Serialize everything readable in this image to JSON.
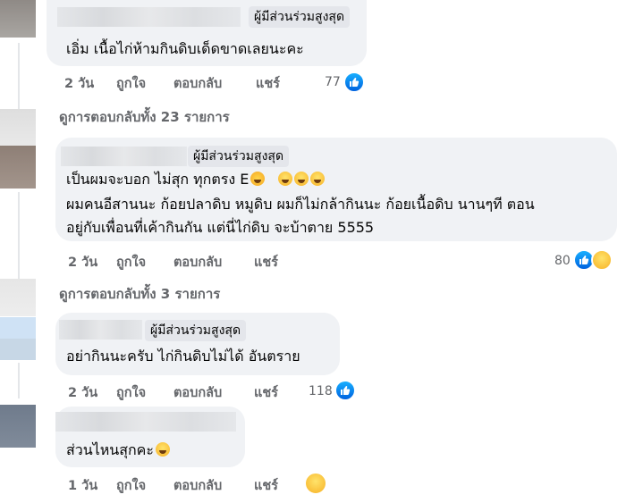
{
  "comments": [
    {
      "badge": "ผู้มีส่วนร่วมสูงสุด",
      "lines": [
        "เอิ่ม เนื้อไก่ห้ามกินดิบเด็ดขาดเลยนะคะ"
      ],
      "age": "2 วัน",
      "like": "ถูกใจ",
      "reply": "ตอบกลับ",
      "share": "แชร์",
      "reaction_count": "77",
      "reactions": [
        "like-icon"
      ]
    },
    {
      "badge": "ผู้มีส่วนร่วมสูงสุด",
      "lines": [
        "เป็นผมจะบอก ไม่สุก ทุกตรง E",
        "ผมคนอีสานนะ ก้อยปลาดิบ หมูดิบ ผมก็ไม่กล้ากินนะ ก้อยเนื้อดิบ นานๆที ตอน",
        "อยู่กับเพื่อนที่เค้ากินกัน แต่นี่ไก่ดิบ จะบ้าตาย 5555"
      ],
      "age": "2 วัน",
      "like": "ถูกใจ",
      "reply": "ตอบกลับ",
      "share": "แชร์",
      "reaction_count": "80",
      "reactions": [
        "like-icon",
        "haha-icon"
      ]
    },
    {
      "badge": "ผู้มีส่วนร่วมสูงสุด",
      "lines": [
        "อย่ากินนะครับ ไก่กินดิบไม่ได้ อันตราย"
      ],
      "age": "2 วัน",
      "like": "ถูกใจ",
      "reply": "ตอบกลับ",
      "share": "แชร์",
      "reaction_count": "118",
      "reactions": [
        "like-icon"
      ]
    },
    {
      "badge": "",
      "lines": [
        "ส่วนไหนสุกคะ"
      ],
      "age": "1 วัน",
      "like": "ถูกใจ",
      "reply": "ตอบกลับ",
      "share": "แชร์",
      "reaction_count": "",
      "reactions": [
        "haha-icon"
      ]
    }
  ],
  "more_replies": [
    "ดูการตอบกลับทั้ง 23 รายการ",
    "ดูการตอบกลับทั้ง 3 รายการ"
  ],
  "colors": {
    "bubble": "#f0f2f5",
    "meta_text": "#65676b",
    "like_blue": "#0866ff",
    "badge_bg": "#e4e6eb"
  }
}
